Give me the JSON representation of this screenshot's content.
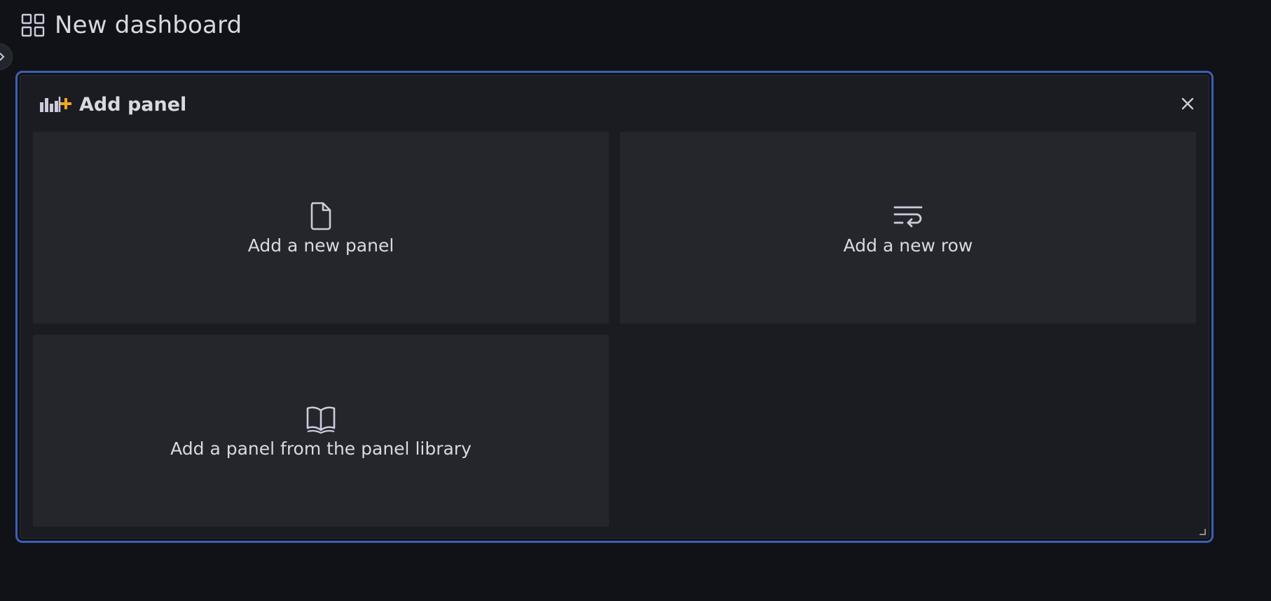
{
  "header": {
    "title": "New dashboard",
    "icon": "dashboard-grid-icon"
  },
  "sidebar_toggle": {
    "icon": "chevron-right-icon"
  },
  "panel": {
    "title": "Add panel",
    "icon": "add-panel-icon",
    "close_icon": "close-icon",
    "accent_color": "#3d5fb6",
    "plus_color": "#f5a623",
    "cards": [
      {
        "label": "Add a new panel",
        "icon": "file-icon"
      },
      {
        "label": "Add a new row",
        "icon": "wrap-row-icon"
      },
      {
        "label": "Add a panel from the panel library",
        "icon": "book-icon"
      }
    ]
  }
}
